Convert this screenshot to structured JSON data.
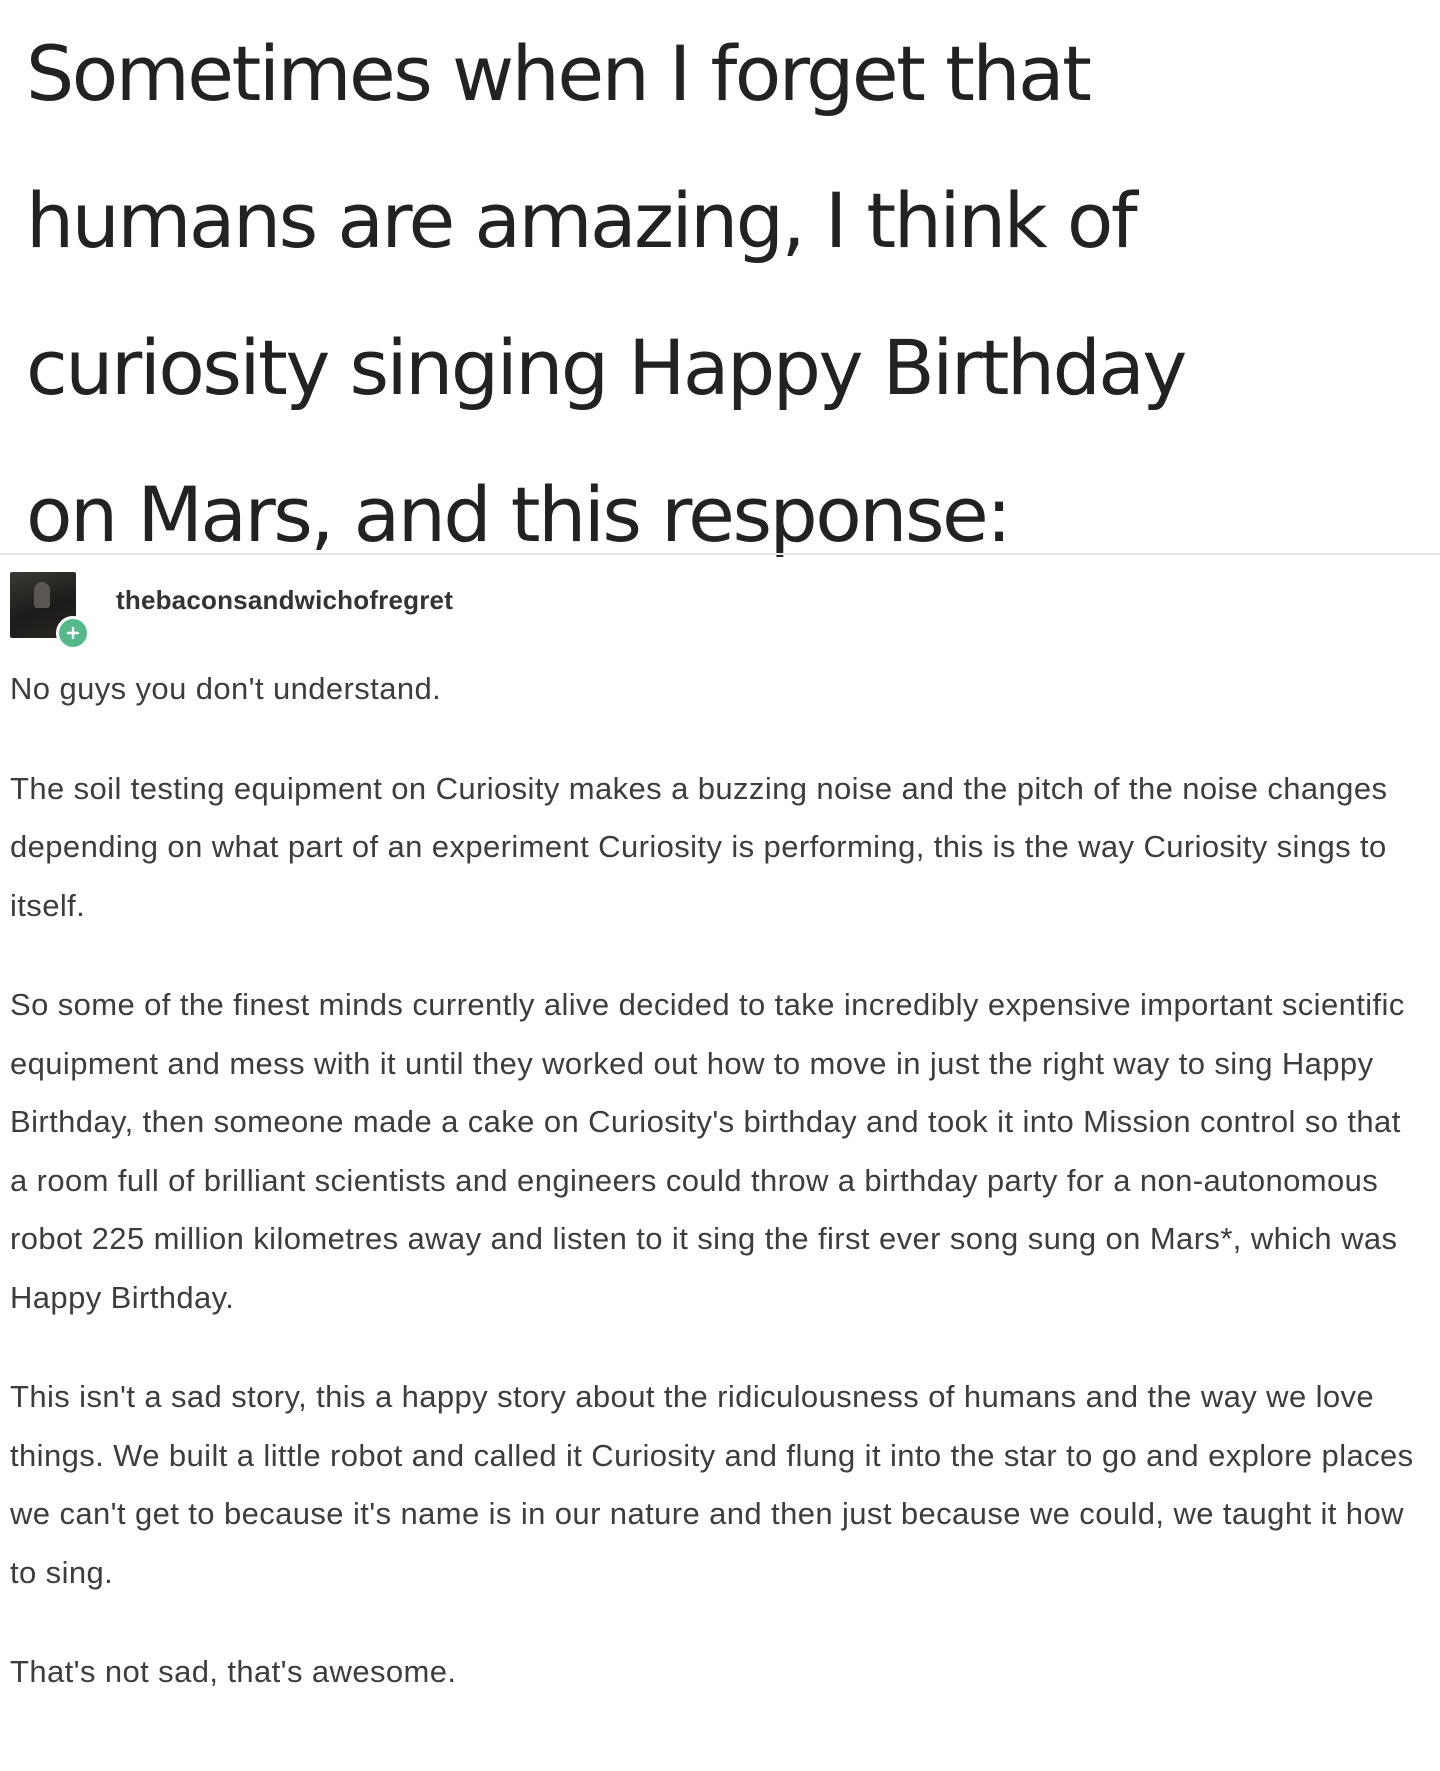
{
  "headline": {
    "lines": [
      "Sometimes when I forget that",
      "humans are amazing, I think of",
      "curiosity singing Happy Birthday",
      "on Mars, and this response:"
    ]
  },
  "post": {
    "username": "thebaconsandwichofregret",
    "avatar_icon": "user-avatar",
    "badge_icon": "follow-plus-icon",
    "paragraphs": [
      "No guys you don't understand.",
      "The soil testing equipment on Curiosity makes a buzzing noise and the pitch of the noise changes depending on what part of an experiment Curiosity is performing, this is the way Curiosity sings to itself.",
      "So some of the finest minds currently alive decided to take incredibly expensive important scientific equipment and mess with it until they worked out how to move in just the right way to sing Happy Birthday, then someone made a cake on Curiosity's birthday and took it into Mission control so that a room full of brilliant scientists and engineers could throw a birthday party for a non-autonomous robot 225 million kilometres away and listen to it sing the first ever song sung on Mars*, which was Happy Birthday.",
      "This isn't a sad story, this a happy story about the ridiculousness of humans and the way we love things. We built a little robot and called it Curiosity and flung it into the star to go and explore places we can't get to because it's name is in our nature and then just because we could, we taught it how to sing.",
      "That's not sad, that's awesome."
    ]
  },
  "colors": {
    "headline_text": "#222222",
    "body_text": "#3d3d3d",
    "badge": "#56b98a"
  }
}
